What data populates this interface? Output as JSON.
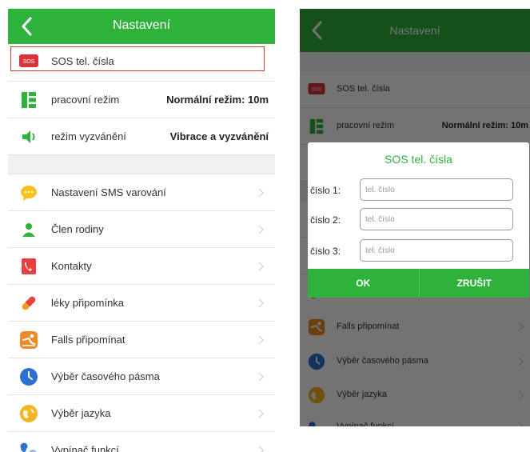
{
  "colors": {
    "accent": "#2fb23b",
    "highlight": "#d8343a",
    "sos_badge": "#d8343a"
  },
  "screen": {
    "title": "Nastavení",
    "sos": {
      "badge": "SOS",
      "label": "SOS tel. čísla"
    },
    "work_mode": {
      "label": "pracovní režim",
      "value": "Normální režim: 10m"
    },
    "ring_mode": {
      "label": "režim vyzvánění",
      "value": "Vibrace a vyzvánění"
    },
    "items": [
      {
        "label": "Nastavení SMS varování",
        "icon": "sms-icon"
      },
      {
        "label": "Člen rodiny",
        "icon": "family-icon"
      },
      {
        "label": "Kontakty",
        "icon": "contacts-icon"
      },
      {
        "label": "léky připomínka",
        "icon": "medicine-icon"
      },
      {
        "label": "Falls připomínat",
        "icon": "fall-icon"
      },
      {
        "label": "Výběr časového pásma",
        "icon": "clock-icon"
      },
      {
        "label": "Výběr jazyka",
        "icon": "globe-icon"
      },
      {
        "label": "Vypínač funkcí",
        "icon": "wrench-icon"
      }
    ]
  },
  "dialog": {
    "title": "SOS tel. čísla",
    "fields": [
      {
        "label": "číslo 1:",
        "placeholder": "tel. číslo",
        "value": ""
      },
      {
        "label": "číslo 2:",
        "placeholder": "tel. číslo",
        "value": ""
      },
      {
        "label": "číslo 3:",
        "placeholder": "tel. číslo",
        "value": ""
      }
    ],
    "ok_label": "OK",
    "cancel_label": "ZRUŠIT"
  }
}
